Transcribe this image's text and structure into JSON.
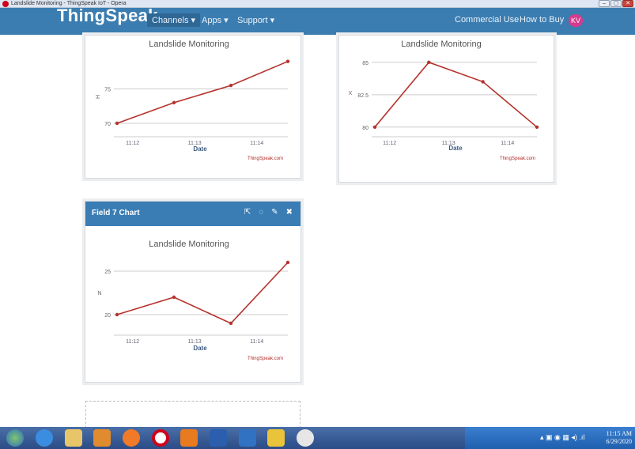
{
  "window": {
    "title": "Landslide Monitoring - ThingSpeak IoT - Opera",
    "controls": [
      "–",
      "▢",
      "✕"
    ]
  },
  "nav": {
    "logo": "ThingSpeak",
    "channels": "Channels ▾",
    "apps": "Apps ▾",
    "support": "Support ▾",
    "commercial": "Commercial Use",
    "howtobuy": "How to Buy",
    "avatar": "KV"
  },
  "charts": [
    {
      "title": "Landslide Monitoring",
      "ylabel": "H",
      "xlabel": "Date",
      "credit": "ThingSpeak.com",
      "yticks": [
        "75",
        "70"
      ],
      "xticks": [
        "11:12",
        "11:13",
        "11:14"
      ]
    },
    {
      "title": "Landslide Monitoring",
      "ylabel": "X",
      "xlabel": "Date",
      "credit": "ThingSpeak.com",
      "yticks": [
        "85",
        "82.5",
        "80"
      ],
      "xticks": [
        "11:12",
        "11:13",
        "11:14"
      ]
    },
    {
      "header": "Field 7 Chart",
      "title": "Landslide Monitoring",
      "ylabel": "N",
      "xlabel": "Date",
      "credit": "ThingSpeak.com",
      "yticks": [
        "25",
        "20"
      ],
      "xticks": [
        "11:12",
        "11:13",
        "11:14"
      ]
    }
  ],
  "chart_data": [
    {
      "type": "line",
      "title": "Landslide Monitoring",
      "xlabel": "Date",
      "ylabel": "H",
      "x": [
        "11:11:45",
        "11:12:40",
        "11:13:35",
        "11:14:30"
      ],
      "series": [
        {
          "values": [
            70,
            73,
            75.5,
            79
          ]
        }
      ],
      "color": "#b5322c",
      "yticks": [
        70,
        75
      ],
      "xticks": [
        "11:12",
        "11:13",
        "11:14"
      ],
      "grid": true
    },
    {
      "type": "line",
      "title": "Landslide Monitoring",
      "xlabel": "Date",
      "ylabel": "X",
      "x": [
        "11:11:45",
        "11:12:40",
        "11:13:35",
        "11:14:30"
      ],
      "series": [
        {
          "values": [
            80,
            85,
            83.5,
            80
          ]
        }
      ],
      "color": "#b5322c",
      "yticks": [
        80,
        82.5,
        85
      ],
      "xticks": [
        "11:12",
        "11:13",
        "11:14"
      ],
      "grid": true
    },
    {
      "type": "line",
      "title": "Landslide Monitoring",
      "xlabel": "Date",
      "ylabel": "N",
      "x": [
        "11:11:45",
        "11:12:40",
        "11:13:35",
        "11:14:30"
      ],
      "series": [
        {
          "values": [
            20,
            22,
            19,
            26
          ]
        }
      ],
      "color": "#b5322c",
      "yticks": [
        20,
        25
      ],
      "xticks": [
        "11:12",
        "11:13",
        "11:14"
      ],
      "grid": true
    }
  ],
  "taskbar": {
    "time": "11:15 AM",
    "date": "6/29/2020",
    "apps": [
      "start-icon",
      "ie-icon",
      "explorer-icon",
      "media-icon",
      "firefox-icon",
      "opera-icon",
      "app-icon",
      "word-icon",
      "vscode-icon",
      "python-icon",
      "chrome-icon"
    ]
  },
  "colors": {
    "nav": "#3b7db0",
    "line": "#b5322c",
    "header": "#3a7db4"
  }
}
